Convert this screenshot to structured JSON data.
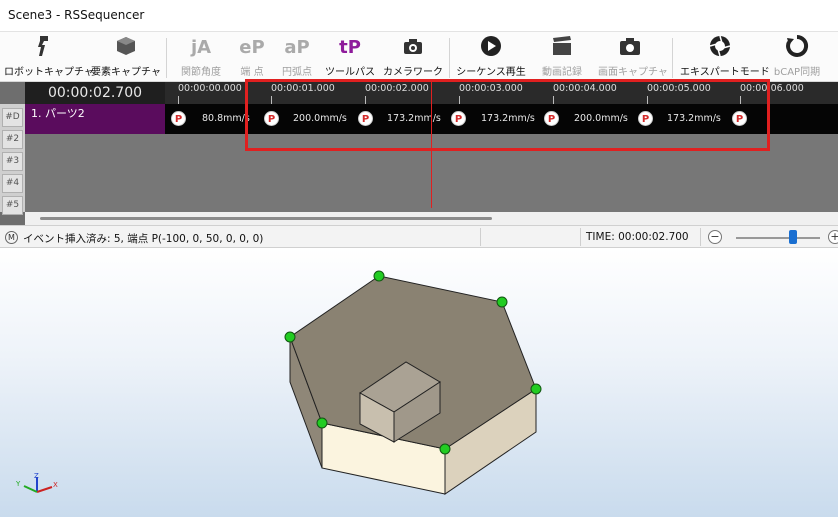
{
  "window": {
    "title": "Scene3 - RSSequencer"
  },
  "toolbar": {
    "items": [
      {
        "label": "ロボットキャプチャ",
        "icon": "robot-capture-icon",
        "enabled": true
      },
      {
        "label": "要素キャプチャ",
        "icon": "element-capture-icon",
        "enabled": true
      },
      {
        "label": "関節角度",
        "icon": "joint-angle-icon",
        "glyph": "jA",
        "enabled": false
      },
      {
        "label": "端 点",
        "icon": "end-point-icon",
        "glyph": "eP",
        "enabled": false
      },
      {
        "label": "円弧点",
        "icon": "arc-point-icon",
        "glyph": "aP",
        "enabled": false
      },
      {
        "label": "ツールパス",
        "icon": "tool-path-icon",
        "glyph": "tP",
        "enabled": true
      },
      {
        "label": "カメラワーク",
        "icon": "camera-work-icon",
        "enabled": true
      },
      {
        "label": "シーケンス再生",
        "icon": "play-sequence-icon",
        "enabled": true
      },
      {
        "label": "動画記録",
        "icon": "video-record-icon",
        "enabled": false
      },
      {
        "label": "画面キャプチャ",
        "icon": "screen-capture-icon",
        "enabled": false
      },
      {
        "label": "エキスパートモード",
        "icon": "expert-mode-icon",
        "enabled": true
      },
      {
        "label": "bCAP同期",
        "icon": "bcap-sync-icon",
        "enabled": false
      }
    ]
  },
  "timeline": {
    "current_time": "00:00:02.700",
    "ruler_labels": [
      "00:00:00.000",
      "00:00:01.000",
      "00:00:02.000",
      "00:00:03.000",
      "00:00:04.000",
      "00:00:05.000",
      "00:00:06.000"
    ],
    "row_headers": [
      "#D",
      "#2",
      "#3",
      "#4",
      "#5"
    ],
    "track_label": "1. パーツ2",
    "point_marker": "P",
    "speeds": [
      "80.8mm/s",
      "200.0mm/s",
      "173.2mm/s",
      "173.2mm/s",
      "200.0mm/s",
      "173.2mm/s"
    ]
  },
  "status": {
    "mode_icon": "M",
    "message": "イベント挿入済み: 5, 端点 P(-100, 0, 50, 0, 0, 0)",
    "time_text": "TIME: 00:00:02.700",
    "zoom_minus": "−",
    "zoom_plus": "+"
  },
  "axes": {
    "x": "X",
    "y": "Y",
    "z": "Z"
  },
  "colors": {
    "track_label_bg": "#5a0c5d",
    "highlight": "#e02020",
    "playhead": "#e02020",
    "vertex_point": "#22cc22",
    "hex_top": "#8a8272",
    "block_front": "#fbf4df",
    "block_side": "#dcd2bd"
  }
}
